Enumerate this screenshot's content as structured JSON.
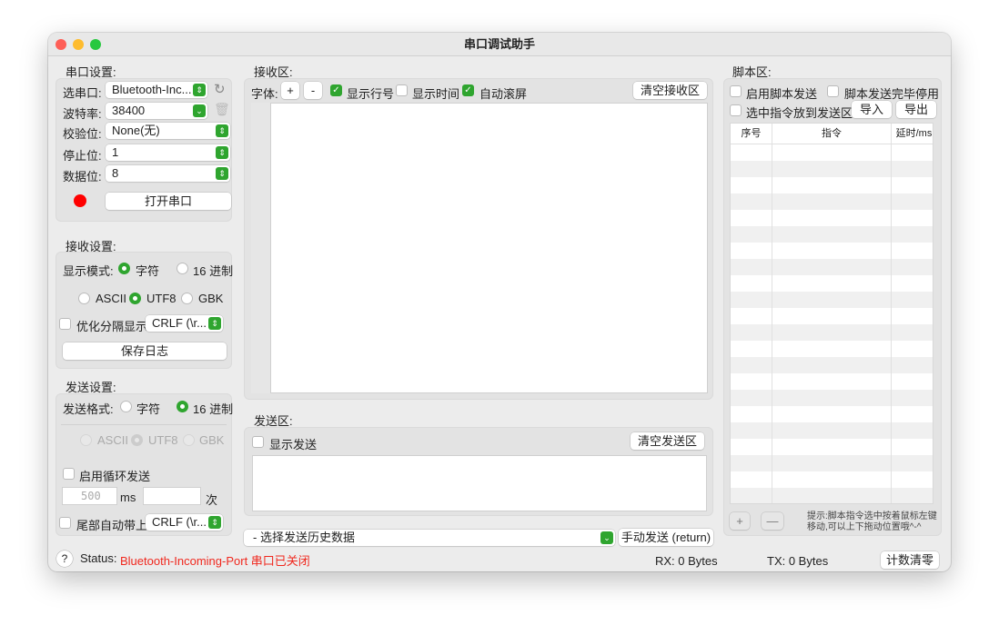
{
  "title": "串口调试助手",
  "serial": {
    "heading": "串口设置:",
    "port_label": "选串口:",
    "port_value": "Bluetooth-Inc...",
    "baud_label": "波特率:",
    "baud_value": "38400",
    "parity_label": "校验位:",
    "parity_value": "None(无)",
    "stop_label": "停止位:",
    "stop_value": "1",
    "data_label": "数据位:",
    "data_value": "8",
    "open_button": "打开串口",
    "status_color": "#ff0000"
  },
  "receive": {
    "heading": "接收设置:",
    "mode_label": "显示模式:",
    "mode_char": "字符",
    "mode_hex": "16 进制",
    "enc_ascii": "ASCII",
    "enc_utf8": "UTF8",
    "enc_gbk": "GBK",
    "optimize_label": "优化分隔显示",
    "optimize_value": "CRLF (\\r...",
    "save_log": "保存日志"
  },
  "send": {
    "heading": "发送设置:",
    "format_label": "发送格式:",
    "fmt_char": "字符",
    "fmt_hex": "16 进制",
    "enc_ascii": "ASCII",
    "enc_utf8": "UTF8",
    "enc_gbk": "GBK",
    "loop_label": "启用循环发送",
    "interval_placeholder": "500",
    "ms": "ms",
    "times": "次",
    "tail_label": "尾部自动带上",
    "tail_value": "CRLF (\\r..."
  },
  "recv_area": {
    "heading": "接收区:",
    "font_label": "字体:",
    "plus": "+",
    "minus": "-",
    "show_line": "显示行号",
    "show_time": "显示时间",
    "auto_scroll": "自动滚屏",
    "clear": "清空接收区"
  },
  "send_area": {
    "heading": "发送区:",
    "show_send": "显示发送",
    "clear": "清空发送区",
    "history": "- 选择发送历史数据",
    "manual_send": "手动发送 (return)"
  },
  "script": {
    "heading": "脚本区:",
    "enable": "启用脚本发送",
    "disable_after": "脚本发送完毕停用",
    "to_send": "选中指令放到发送区",
    "import": "导入",
    "export": "导出",
    "columns": [
      "序号",
      "指令",
      "延时/ms"
    ],
    "add": "+",
    "remove": "—",
    "hint": "提示:脚本指令选中按着鼠标左键移动,可以上下拖动位置哦^-^"
  },
  "status": {
    "help": "?",
    "label": "Status:",
    "message": "Bluetooth-Incoming-Port 串口已关闭",
    "rx": "RX:  0 Bytes",
    "tx": "TX: 0 Bytes",
    "reset": "计数清零"
  }
}
